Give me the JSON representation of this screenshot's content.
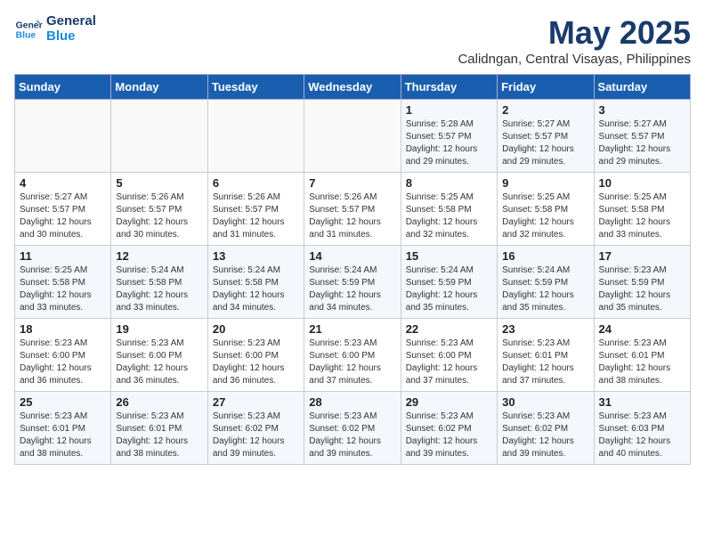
{
  "header": {
    "logo_line1": "General",
    "logo_line2": "Blue",
    "month": "May 2025",
    "location": "Calidngan, Central Visayas, Philippines"
  },
  "weekdays": [
    "Sunday",
    "Monday",
    "Tuesday",
    "Wednesday",
    "Thursday",
    "Friday",
    "Saturday"
  ],
  "weeks": [
    [
      {
        "day": "",
        "info": ""
      },
      {
        "day": "",
        "info": ""
      },
      {
        "day": "",
        "info": ""
      },
      {
        "day": "",
        "info": ""
      },
      {
        "day": "1",
        "info": "Sunrise: 5:28 AM\nSunset: 5:57 PM\nDaylight: 12 hours\nand 29 minutes."
      },
      {
        "day": "2",
        "info": "Sunrise: 5:27 AM\nSunset: 5:57 PM\nDaylight: 12 hours\nand 29 minutes."
      },
      {
        "day": "3",
        "info": "Sunrise: 5:27 AM\nSunset: 5:57 PM\nDaylight: 12 hours\nand 29 minutes."
      }
    ],
    [
      {
        "day": "4",
        "info": "Sunrise: 5:27 AM\nSunset: 5:57 PM\nDaylight: 12 hours\nand 30 minutes."
      },
      {
        "day": "5",
        "info": "Sunrise: 5:26 AM\nSunset: 5:57 PM\nDaylight: 12 hours\nand 30 minutes."
      },
      {
        "day": "6",
        "info": "Sunrise: 5:26 AM\nSunset: 5:57 PM\nDaylight: 12 hours\nand 31 minutes."
      },
      {
        "day": "7",
        "info": "Sunrise: 5:26 AM\nSunset: 5:57 PM\nDaylight: 12 hours\nand 31 minutes."
      },
      {
        "day": "8",
        "info": "Sunrise: 5:25 AM\nSunset: 5:58 PM\nDaylight: 12 hours\nand 32 minutes."
      },
      {
        "day": "9",
        "info": "Sunrise: 5:25 AM\nSunset: 5:58 PM\nDaylight: 12 hours\nand 32 minutes."
      },
      {
        "day": "10",
        "info": "Sunrise: 5:25 AM\nSunset: 5:58 PM\nDaylight: 12 hours\nand 33 minutes."
      }
    ],
    [
      {
        "day": "11",
        "info": "Sunrise: 5:25 AM\nSunset: 5:58 PM\nDaylight: 12 hours\nand 33 minutes."
      },
      {
        "day": "12",
        "info": "Sunrise: 5:24 AM\nSunset: 5:58 PM\nDaylight: 12 hours\nand 33 minutes."
      },
      {
        "day": "13",
        "info": "Sunrise: 5:24 AM\nSunset: 5:58 PM\nDaylight: 12 hours\nand 34 minutes."
      },
      {
        "day": "14",
        "info": "Sunrise: 5:24 AM\nSunset: 5:59 PM\nDaylight: 12 hours\nand 34 minutes."
      },
      {
        "day": "15",
        "info": "Sunrise: 5:24 AM\nSunset: 5:59 PM\nDaylight: 12 hours\nand 35 minutes."
      },
      {
        "day": "16",
        "info": "Sunrise: 5:24 AM\nSunset: 5:59 PM\nDaylight: 12 hours\nand 35 minutes."
      },
      {
        "day": "17",
        "info": "Sunrise: 5:23 AM\nSunset: 5:59 PM\nDaylight: 12 hours\nand 35 minutes."
      }
    ],
    [
      {
        "day": "18",
        "info": "Sunrise: 5:23 AM\nSunset: 6:00 PM\nDaylight: 12 hours\nand 36 minutes."
      },
      {
        "day": "19",
        "info": "Sunrise: 5:23 AM\nSunset: 6:00 PM\nDaylight: 12 hours\nand 36 minutes."
      },
      {
        "day": "20",
        "info": "Sunrise: 5:23 AM\nSunset: 6:00 PM\nDaylight: 12 hours\nand 36 minutes."
      },
      {
        "day": "21",
        "info": "Sunrise: 5:23 AM\nSunset: 6:00 PM\nDaylight: 12 hours\nand 37 minutes."
      },
      {
        "day": "22",
        "info": "Sunrise: 5:23 AM\nSunset: 6:00 PM\nDaylight: 12 hours\nand 37 minutes."
      },
      {
        "day": "23",
        "info": "Sunrise: 5:23 AM\nSunset: 6:01 PM\nDaylight: 12 hours\nand 37 minutes."
      },
      {
        "day": "24",
        "info": "Sunrise: 5:23 AM\nSunset: 6:01 PM\nDaylight: 12 hours\nand 38 minutes."
      }
    ],
    [
      {
        "day": "25",
        "info": "Sunrise: 5:23 AM\nSunset: 6:01 PM\nDaylight: 12 hours\nand 38 minutes."
      },
      {
        "day": "26",
        "info": "Sunrise: 5:23 AM\nSunset: 6:01 PM\nDaylight: 12 hours\nand 38 minutes."
      },
      {
        "day": "27",
        "info": "Sunrise: 5:23 AM\nSunset: 6:02 PM\nDaylight: 12 hours\nand 39 minutes."
      },
      {
        "day": "28",
        "info": "Sunrise: 5:23 AM\nSunset: 6:02 PM\nDaylight: 12 hours\nand 39 minutes."
      },
      {
        "day": "29",
        "info": "Sunrise: 5:23 AM\nSunset: 6:02 PM\nDaylight: 12 hours\nand 39 minutes."
      },
      {
        "day": "30",
        "info": "Sunrise: 5:23 AM\nSunset: 6:02 PM\nDaylight: 12 hours\nand 39 minutes."
      },
      {
        "day": "31",
        "info": "Sunrise: 5:23 AM\nSunset: 6:03 PM\nDaylight: 12 hours\nand 40 minutes."
      }
    ]
  ]
}
